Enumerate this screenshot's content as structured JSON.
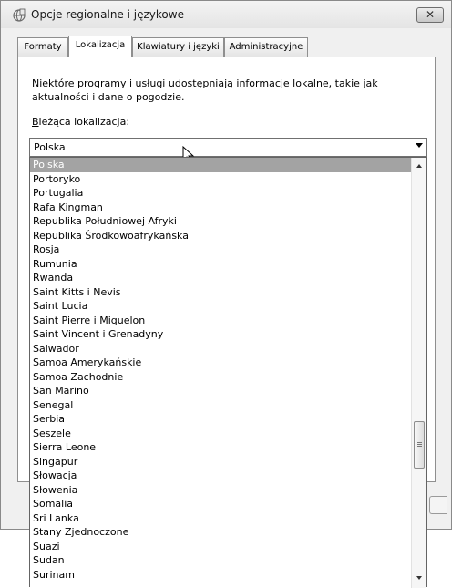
{
  "window": {
    "title": "Opcje regionalne i językowe",
    "close_symbol": "✕"
  },
  "tabs": [
    {
      "label": "Formaty"
    },
    {
      "label": "Lokalizacja"
    },
    {
      "label": "Klawiatury i języki"
    },
    {
      "label": "Administracyjne"
    }
  ],
  "panel": {
    "description": "Niektóre programy i usługi udostępniają informacje lokalne, takie jak aktualności i dane o pogodzie.",
    "current_location_label_first": "B",
    "current_location_label_rest": "ieżąca lokalizacja:"
  },
  "combo": {
    "value": "Polska"
  },
  "dropdown": {
    "items": [
      "Polska",
      "Portoryko",
      "Portugalia",
      "Rafa Kingman",
      "Republika Południowej Afryki",
      "Republika Środkowoafrykańska",
      "Rosja",
      "Rumunia",
      "Rwanda",
      "Saint Kitts i Nevis",
      "Saint Lucia",
      "Saint Pierre i Miquelon",
      "Saint Vincent i Grenadyny",
      "Salwador",
      "Samoa Amerykańskie",
      "Samoa Zachodnie",
      "San Marino",
      "Senegal",
      "Serbia",
      "Seszele",
      "Sierra Leone",
      "Singapur",
      "Słowacja",
      "Słowenia",
      "Somalia",
      "Sri Lanka",
      "Stany Zjednoczone",
      "Suazi",
      "Sudan",
      "Surinam"
    ],
    "selected_index": 0
  },
  "colors": {
    "selection": "#a3a3a3",
    "window_bg": "#f0f0f0"
  }
}
